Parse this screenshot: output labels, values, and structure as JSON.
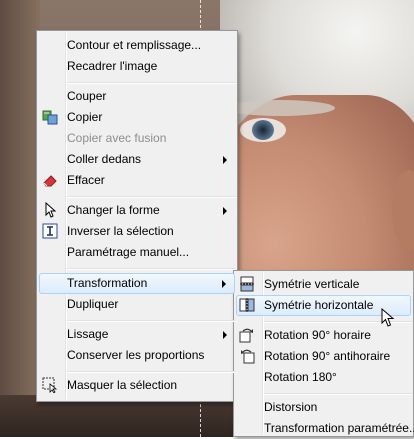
{
  "context_menu": {
    "items": [
      {
        "label": "Contour et remplissage..."
      },
      {
        "label": "Recadrer l'image"
      },
      {
        "label": "Couper"
      },
      {
        "label": "Copier",
        "icon": "copy-icon"
      },
      {
        "label": "Copier avec fusion",
        "disabled": true
      },
      {
        "label": "Coller dedans",
        "has_submenu": true
      },
      {
        "label": "Effacer",
        "icon": "eraser-icon"
      },
      {
        "label": "Changer la forme",
        "icon": "pointer-arrow-icon",
        "has_submenu": true
      },
      {
        "label": "Inverser la sélection",
        "icon": "text-cursor-icon"
      },
      {
        "label": "Paramétrage manuel..."
      },
      {
        "label": "Transformation",
        "has_submenu": true,
        "active": true
      },
      {
        "label": "Dupliquer"
      },
      {
        "label": "Lissage",
        "has_submenu": true
      },
      {
        "label": "Conserver les proportions"
      },
      {
        "label": "Masquer la sélection",
        "icon": "hide-selection-icon"
      }
    ]
  },
  "transformation_submenu": {
    "items": [
      {
        "label": "Symétrie verticale",
        "icon": "flip-vertical-icon"
      },
      {
        "label": "Symétrie horizontale",
        "icon": "flip-horizontal-icon",
        "hovered": true
      },
      {
        "label": "Rotation 90° horaire",
        "icon": "rotate-clockwise-icon"
      },
      {
        "label": "Rotation 90° antihoraire",
        "icon": "rotate-counterclockwise-icon"
      },
      {
        "label": "Rotation 180°"
      },
      {
        "label": "Distorsion"
      },
      {
        "label": "Transformation paramétrée..."
      }
    ]
  },
  "colors": {
    "menu_background": "#f0f0f0",
    "highlight_border": "#a8d3fb",
    "disabled_text": "#8d8d8d"
  }
}
